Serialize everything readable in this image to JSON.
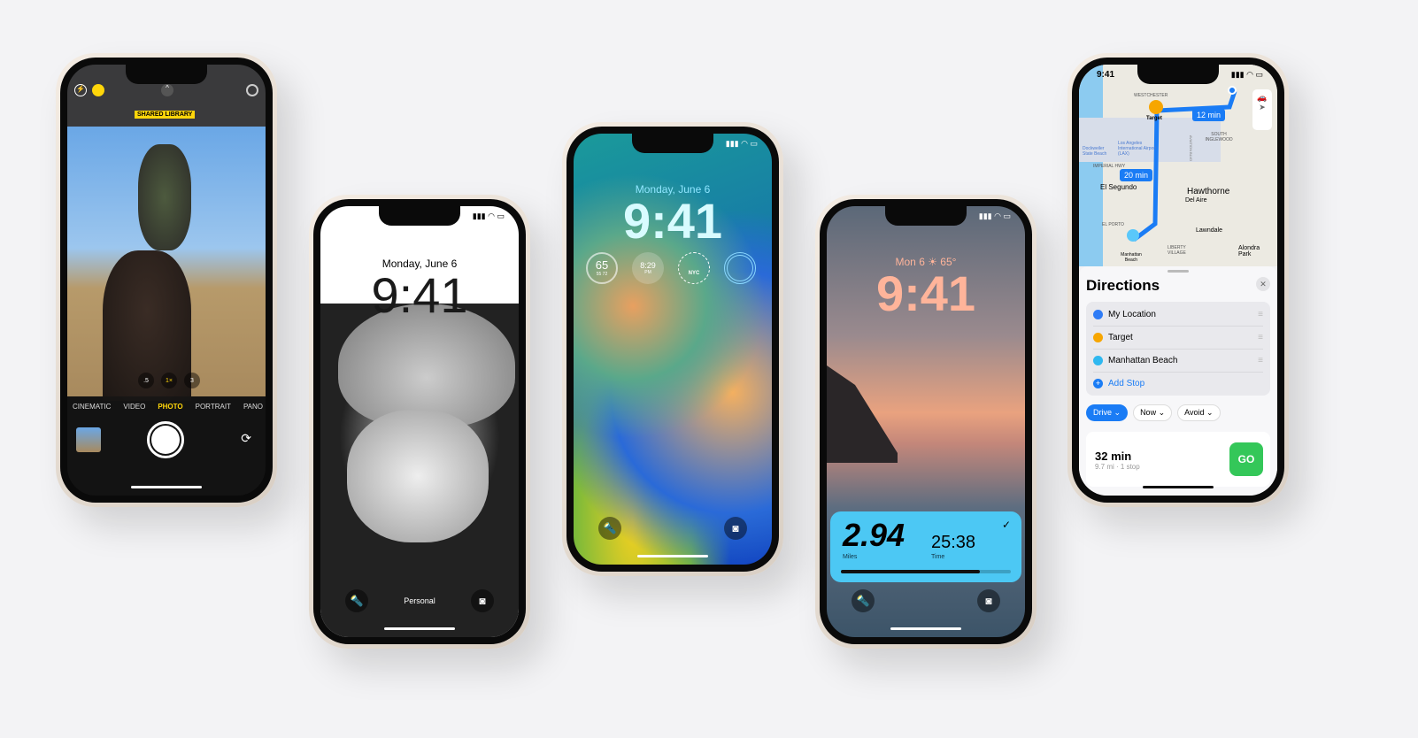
{
  "camera": {
    "shared_library": "SHARED LIBRARY",
    "zoom": [
      ".5",
      "1×",
      "3"
    ],
    "modes": [
      "CINEMATIC",
      "VIDEO",
      "PHOTO",
      "PORTRAIT",
      "PANO"
    ],
    "active_mode": "PHOTO"
  },
  "lock_bw": {
    "date": "Monday, June 6",
    "time": "9:41",
    "focus": "Personal"
  },
  "lock_blue": {
    "date": "Monday, June 6",
    "time": "9:41",
    "widgets": {
      "temp": "65",
      "range": "55  72",
      "sunset": "8:29",
      "sunset_period": "PM",
      "clock_city": "NYC"
    }
  },
  "lock_sunset": {
    "date": "Mon 6",
    "weather": "☀ 65°",
    "time": "9:41",
    "activity": {
      "miles": "2.94",
      "miles_label": "Miles",
      "time": "25:38",
      "time_label": "Time",
      "progress": 0.82
    }
  },
  "maps": {
    "status_time": "9:41",
    "map_labels": [
      "WESTCHESTER",
      "Target",
      "SOUTH INGLEWOOD",
      "Los Angeles International Airport (LAX)",
      "Dockweiler State Beach",
      "IMPERIAL HWY",
      "El Segundo",
      "Hawthorne",
      "Del Aire",
      "EL PORTO",
      "Lawndale",
      "Manhattan Beach",
      "LIBERTY VILLAGE",
      "Alondra Park",
      "AVIATION BLVD"
    ],
    "route_badges": [
      "12 min",
      "20 min"
    ],
    "title": "Directions",
    "stops": [
      {
        "label": "My Location",
        "color": "#2f7cf6"
      },
      {
        "label": "Target",
        "color": "#f7a600"
      },
      {
        "label": "Manhattan Beach",
        "color": "#2fb8f0"
      }
    ],
    "add_stop": "Add Stop",
    "options": [
      "Drive",
      "Now",
      "Avoid"
    ],
    "route": {
      "duration": "32 min",
      "details": "9.7 mi · 1 stop",
      "go": "GO"
    },
    "accent": "#1a7cf5",
    "go_color": "#34c759"
  }
}
